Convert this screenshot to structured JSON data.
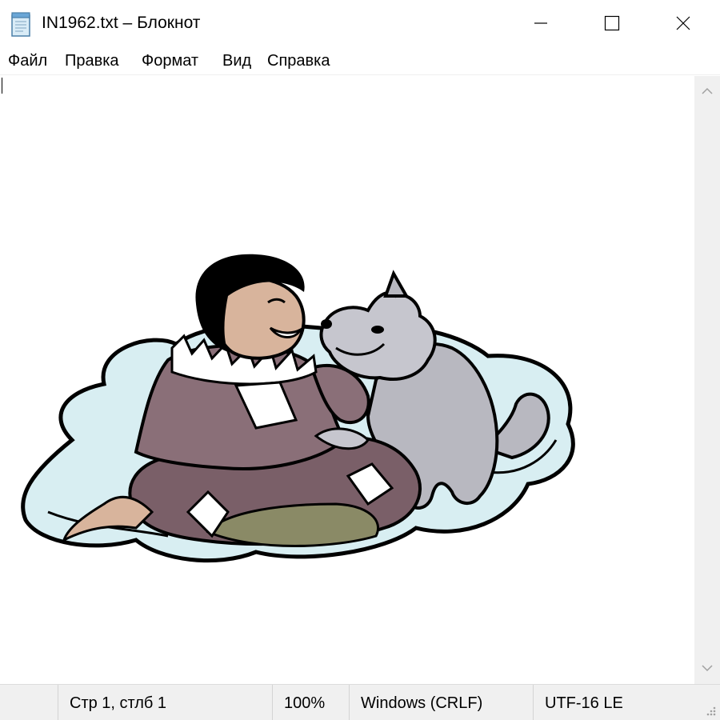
{
  "window": {
    "title": "IN1962.txt – Блокнот"
  },
  "menu": {
    "items": [
      "Файл",
      "Правка",
      "Формат",
      "Вид",
      "Справка"
    ]
  },
  "status": {
    "position": "Стр 1, стлб 1",
    "zoom": "100%",
    "line_endings": "Windows (CRLF)",
    "encoding": "UTF-16 LE"
  },
  "icons": {
    "app": "notepad-icon",
    "minimize": "minimize-icon",
    "maximize": "maximize-icon",
    "close": "close-icon",
    "scroll_up": "chevron-up-icon",
    "scroll_down": "chevron-down-icon",
    "grip": "resize-grip-icon"
  },
  "colors": {
    "ice": "#d8eef2",
    "parka": "#8a6f78",
    "fur": "#ffffff",
    "skin": "#d8b49c",
    "hair": "#000000",
    "dog": "#b8b8c0",
    "pants": "#8a8a66",
    "chrome": "#f0f0f0"
  }
}
